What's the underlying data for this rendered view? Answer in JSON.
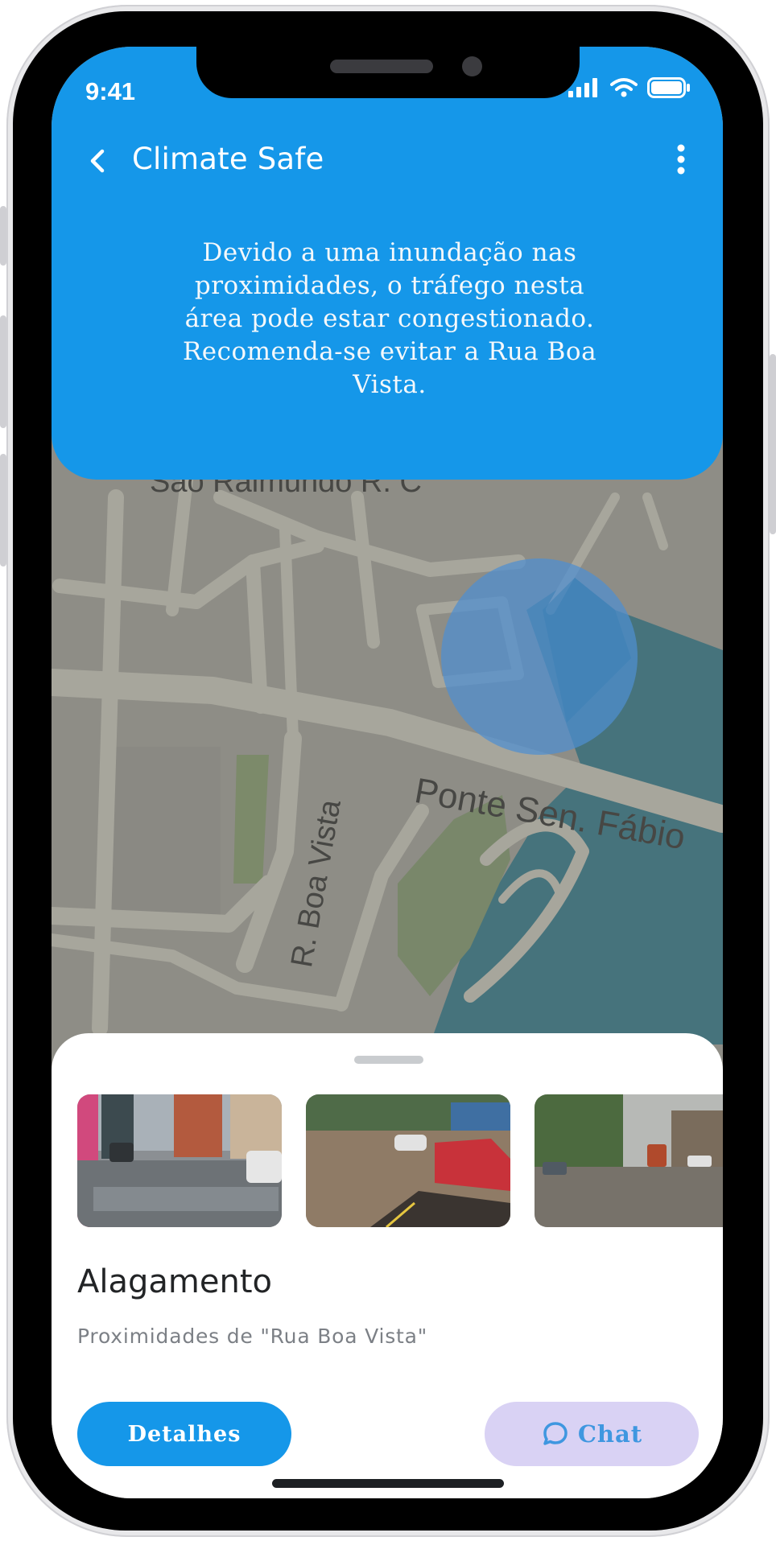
{
  "status_bar": {
    "time": "9:41",
    "icons": [
      "signal-icon",
      "wifi-icon",
      "battery-icon"
    ]
  },
  "header": {
    "title": "Climate Safe",
    "back_icon": "chevron-left-icon",
    "menu_icon": "more-vertical-icon",
    "alert_message": "Devido a uma inundação nas proximidades, o tráfego nesta área pode estar congestionado. Recomenda-se evitar a Rua Boa Vista."
  },
  "map": {
    "labels": {
      "street_top": "São Raimundo R. C",
      "bridge": "Ponte Sen. Fábio",
      "boa_vista": "R. Boa Vista"
    },
    "flood_marker_color": "#4f8fd1"
  },
  "sheet": {
    "photos": [
      {
        "name": "flood-photo-1"
      },
      {
        "name": "flood-photo-2"
      },
      {
        "name": "flood-photo-3"
      }
    ],
    "title": "Alagamento",
    "subtitle": "Proximidades de \"Rua Boa Vista\"",
    "details_label": "Detalhes",
    "chat_label": "Chat",
    "chat_icon": "chat-bubble-icon"
  },
  "colors": {
    "primary": "#1597e9",
    "chat_bg": "#d9d2f4",
    "water": "#46737c"
  }
}
